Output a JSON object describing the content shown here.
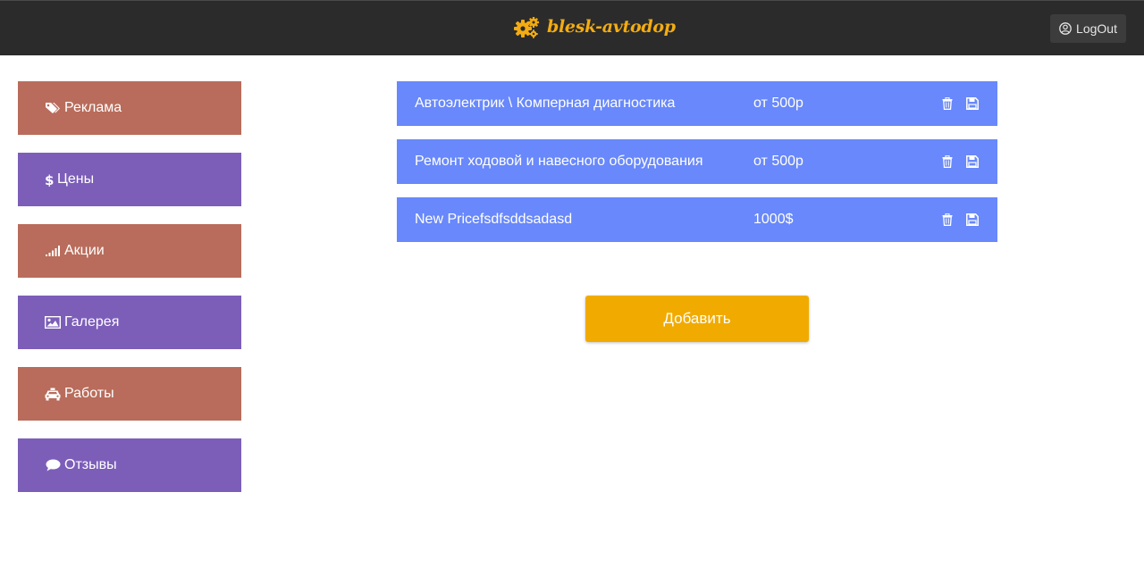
{
  "header": {
    "brand": "blesk-avtodop",
    "logout_label": "LogOut"
  },
  "colors": {
    "topbar": "#2b2b2b",
    "brand": "#f3ac12",
    "sidebar_red": "#b96c5b",
    "sidebar_purple": "#7c5eb9",
    "row_blue": "#6888fb",
    "add_button": "#f1ab00"
  },
  "sidebar": {
    "items": [
      {
        "label": "Реклама",
        "icon": "tags-icon",
        "color": "#b96c5b"
      },
      {
        "label": "Цены",
        "icon": "dollar-icon",
        "color": "#7c5eb9"
      },
      {
        "label": "Акции",
        "icon": "signal-icon",
        "color": "#b96c5b"
      },
      {
        "label": "Галерея",
        "icon": "image-icon",
        "color": "#7c5eb9"
      },
      {
        "label": "Работы",
        "icon": "taxi-icon",
        "color": "#b96c5b"
      },
      {
        "label": "Отзывы",
        "icon": "comment-icon",
        "color": "#7c5eb9"
      }
    ]
  },
  "prices": [
    {
      "name": "Автоэлектрик \\ Комперная диагностика",
      "value": "от 500р"
    },
    {
      "name": "Ремонт ходовой и навесного оборудования",
      "value": "от 500р"
    },
    {
      "name": "New Pricefsdfsddsadasd",
      "value": "1000$"
    }
  ],
  "actions": {
    "add_label": "Добавить"
  }
}
